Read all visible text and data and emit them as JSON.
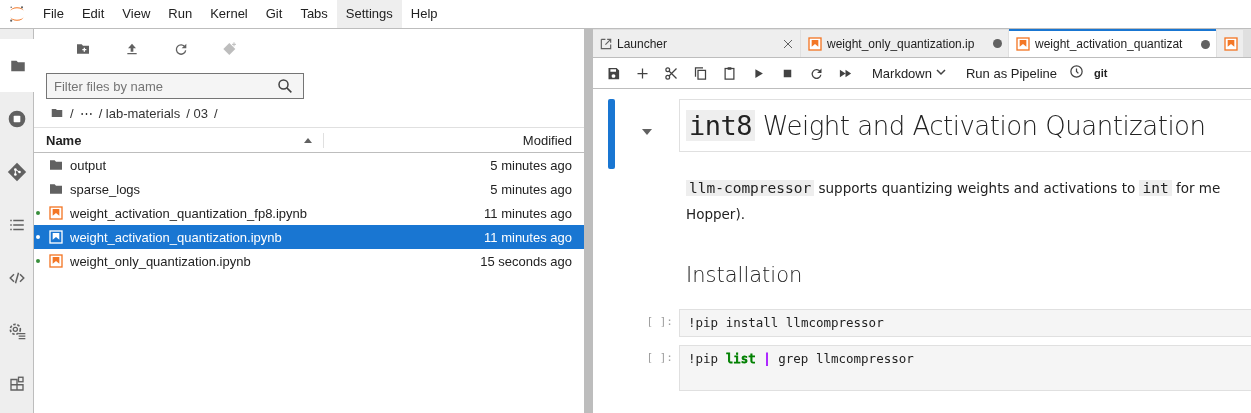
{
  "menu": [
    {
      "label": "File",
      "selected": false
    },
    {
      "label": "Edit",
      "selected": false
    },
    {
      "label": "View",
      "selected": false
    },
    {
      "label": "Run",
      "selected": false
    },
    {
      "label": "Kernel",
      "selected": false
    },
    {
      "label": "Git",
      "selected": false
    },
    {
      "label": "Tabs",
      "selected": false
    },
    {
      "label": "Settings",
      "selected": true
    },
    {
      "label": "Help",
      "selected": false
    }
  ],
  "sidebar": {
    "items": [
      {
        "selected": true
      },
      {
        "selected": false
      },
      {
        "selected": false
      },
      {
        "selected": false
      },
      {
        "selected": false
      },
      {
        "selected": false
      },
      {
        "selected": false
      }
    ]
  },
  "file_browser": {
    "filter": {
      "placeholder": "Filter files by name"
    },
    "breadcrumbs": [
      "/",
      "⋯",
      "/ lab-materials",
      "/ 03",
      "/"
    ],
    "columns": [
      "Name",
      "Modified"
    ],
    "rows": [
      {
        "name": "output",
        "modified": "5 minutes ago",
        "kind": "folder",
        "running": false,
        "selected": false
      },
      {
        "name": "sparse_logs",
        "modified": "5 minutes ago",
        "kind": "folder",
        "running": false,
        "selected": false
      },
      {
        "name": "weight_activation_quantization_fp8.ipynb",
        "modified": "11 minutes ago",
        "kind": "notebook",
        "running": true,
        "selected": false
      },
      {
        "name": "weight_activation_quantization.ipynb",
        "modified": "11 minutes ago",
        "kind": "notebook",
        "running": true,
        "selected": true
      },
      {
        "name": "weight_only_quantization.ipynb",
        "modified": "15 seconds ago",
        "kind": "notebook",
        "running": true,
        "selected": false
      }
    ]
  },
  "tabs": [
    {
      "label": "Launcher",
      "kind": "launcher",
      "selected": false,
      "dirty": false
    },
    {
      "label": "weight_only_quantization.ip",
      "kind": "notebook",
      "selected": false,
      "dirty": true
    },
    {
      "label": "weight_activation_quantizat",
      "kind": "notebook",
      "selected": true,
      "dirty": true
    }
  ],
  "toolbar": {
    "cell_type": "Markdown",
    "pipeline": "Run as Pipeline",
    "git": "git"
  },
  "cells": [
    {
      "kind": "heading",
      "active": true,
      "code": "int8",
      "text": "Weight and Activation Quantization"
    },
    {
      "kind": "paragraph",
      "active": false,
      "lines": [
        [
          {
            "text": "llm-compressor",
            "code": true
          },
          {
            "text": " supports quantizing weights and activations to ",
            "code": false
          },
          {
            "text": "int",
            "code": true
          },
          {
            "text": " for me",
            "code": false
          }
        ],
        [
          {
            "text": "Hopper).",
            "code": false
          }
        ]
      ]
    },
    {
      "kind": "subheading",
      "active": false,
      "text": "Installation"
    },
    {
      "kind": "code",
      "active": false,
      "prompt": "[ ]:",
      "tokens": [
        {
          "text": "!pip install llmcompressor"
        }
      ]
    },
    {
      "kind": "code",
      "active": false,
      "prompt": "[ ]:",
      "tokens": [
        {
          "text": "!pip"
        },
        {
          "text": "list",
          "color": "#008000"
        },
        {
          "text": "|",
          "color": "#aa22ff"
        },
        {
          "text": "grep llmcompressor"
        }
      ]
    }
  ]
}
